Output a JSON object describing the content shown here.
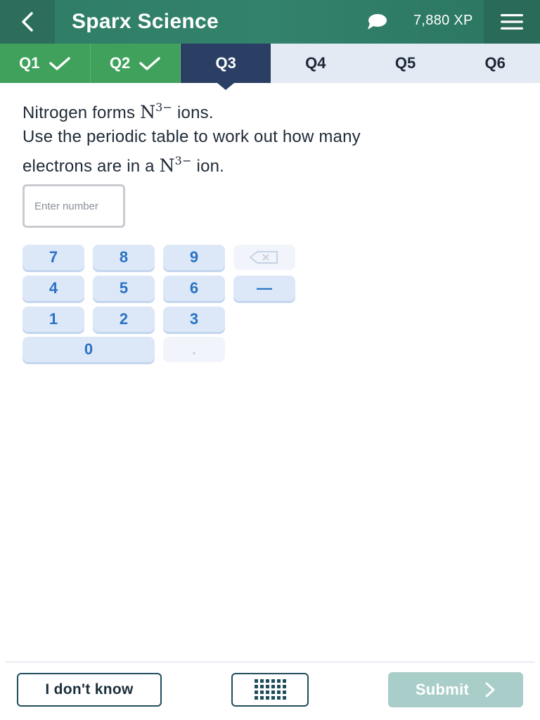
{
  "header": {
    "app_title": "Sparx Science",
    "xp": "7,880 XP",
    "back_icon": "chevron-left-icon",
    "chat_icon": "chat-bubble-icon",
    "menu_icon": "hamburger-menu-icon",
    "colors": {
      "header_bg": "#2f7d66",
      "back_bg": "#2c6e5b",
      "menu_bg": "#2a6a58"
    }
  },
  "tabs": [
    {
      "label": "Q1",
      "state": "completed"
    },
    {
      "label": "Q2",
      "state": "completed"
    },
    {
      "label": "Q3",
      "state": "active"
    },
    {
      "label": "Q4",
      "state": "unanswered"
    },
    {
      "label": "Q5",
      "state": "unanswered"
    },
    {
      "label": "Q6",
      "state": "unanswered"
    }
  ],
  "question": {
    "line1_before": "Nitrogen forms",
    "line1_after": "ions.",
    "line2": "Use the periodic table to work out how many",
    "line3_before": "electrons are in a",
    "line3_after": "ion.",
    "ion_symbol": "N",
    "ion_charge": "3−"
  },
  "answer": {
    "value": "",
    "placeholder": "Enter number"
  },
  "keypad": {
    "keys": [
      "7",
      "8",
      "9",
      "4",
      "5",
      "6",
      "1",
      "2",
      "3",
      "0",
      "."
    ],
    "minus": "—",
    "backspace_icon": "backspace-icon",
    "disabled": [
      "backspace",
      "."
    ]
  },
  "footer": {
    "dont_know": "I don't know",
    "keypad_icon": "keypad-icon",
    "submit": "Submit",
    "submit_icon": "chevron-right-icon"
  },
  "colors": {
    "completed_tab": "#3fa15c",
    "active_tab": "#2a3f63",
    "inactive_tab": "#e4eaf3",
    "key_bg": "#dce8f7",
    "key_text": "#2a72c6",
    "submit_bg": "#a9cdc9"
  }
}
